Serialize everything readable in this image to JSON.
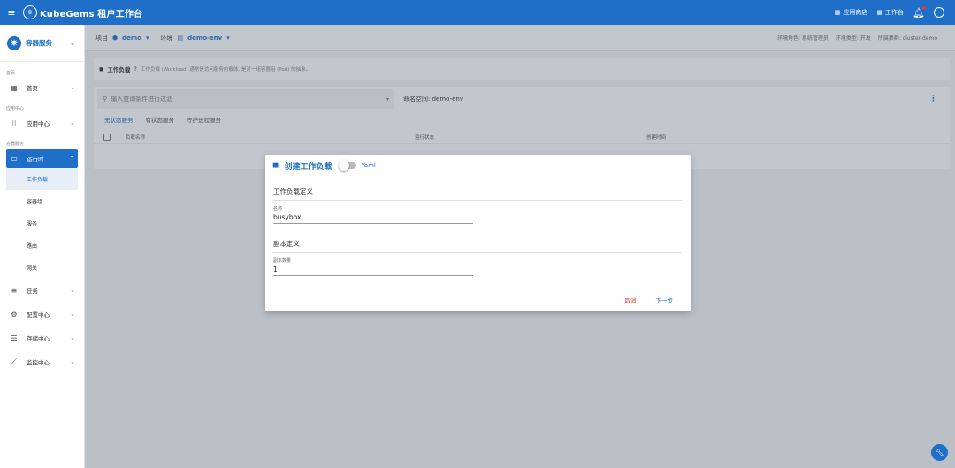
{
  "app": {
    "brand": "KubeGems 租户工作台"
  },
  "topbar": {
    "app_store": "应用商店",
    "workspace": "工作台"
  },
  "sidebar": {
    "module": "容器服务",
    "sections": {
      "home": "首页",
      "apps": "应用中心",
      "container": "容器服务"
    },
    "items": {
      "home": "首页",
      "app_center": "应用中心",
      "runtime": "运行时",
      "workload": "工作负载",
      "pods": "容器组",
      "service": "服务",
      "route": "路由",
      "gateway": "网关",
      "tasks": "任务",
      "config": "配置中心",
      "storage": "存储中心",
      "monitor": "监控中心"
    }
  },
  "context": {
    "project_label": "项目",
    "project": "demo",
    "env_label": "环境",
    "env": "demo-env",
    "role": "环境角色: 系统管理员",
    "env_type": "环境类型: 开发",
    "cluster": "所属集群: cluster-demo"
  },
  "description": {
    "title": "工作负载",
    "hint": "工作负载 (Workload) 通常是访问服务的载体, 是对一组容器组 (Pod) 的抽象。"
  },
  "list": {
    "search_placeholder": "输入查询条件进行过滤",
    "namespace": "命名空间: demo-env",
    "tabs": [
      "无状态服务",
      "有状态服务",
      "守护进程服务"
    ],
    "columns": [
      "负载名称",
      "运行状态",
      "创建时间"
    ]
  },
  "dialog": {
    "title": "创建工作负载",
    "yaml_label": "Yaml",
    "section_workload": "工作负载定义",
    "name_label": "名称",
    "name_value": "busybox",
    "section_replica": "副本定义",
    "replica_label": "副本数量",
    "replica_value": "1",
    "cancel": "取消",
    "next": "下一步"
  }
}
